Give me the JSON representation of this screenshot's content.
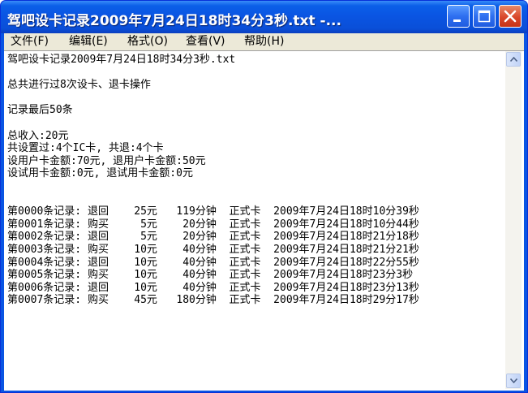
{
  "window": {
    "title": "驾吧设卡记录2009年7月24日18时34分3秒.txt -..."
  },
  "menu": {
    "file": "文件(F)",
    "edit": "编辑(E)",
    "format": "格式(O)",
    "view": "查看(V)",
    "help": "帮助(H)"
  },
  "document": {
    "lines": [
      "驾吧设卡记录2009年7月24日18时34分3秒.txt",
      "",
      "总共进行过8次设卡、退卡操作",
      "",
      "记录最后50条",
      "",
      "总收入:20元",
      "共设置过:4个IC卡, 共退:4个卡",
      "设用户卡金额:70元, 退用户卡金额:50元",
      "设试用卡金额:0元, 退试用卡金额:0元",
      "",
      "",
      "第0000条记录: 退回    25元   119分钟  正式卡  2009年7月24日18时10分39秒",
      "第0001条记录: 购买     5元    20分钟  正式卡  2009年7月24日18时10分44秒",
      "第0002条记录: 退回     5元    20分钟  正式卡  2009年7月24日18时21分18秒",
      "第0003条记录: 购买    10元    40分钟  正式卡  2009年7月24日18时21分21秒",
      "第0004条记录: 退回    10元    40分钟  正式卡  2009年7月24日18时22分55秒",
      "第0005条记录: 购买    10元    40分钟  正式卡  2009年7月24日18时23分3秒",
      "第0006条记录: 退回    10元    40分钟  正式卡  2009年7月24日18时23分13秒",
      "第0007条记录: 购买    45元   180分钟  正式卡  2009年7月24日18时29分17秒"
    ]
  },
  "icons": {
    "minimize": "minimize-icon",
    "maximize": "maximize-icon",
    "close": "close-icon",
    "scroll_up": "arrow-up-icon",
    "scroll_down": "arrow-down-icon"
  },
  "colors": {
    "titlebar": "#0a55e3",
    "close_button": "#d9472a",
    "menubar": "#ece9d8"
  }
}
